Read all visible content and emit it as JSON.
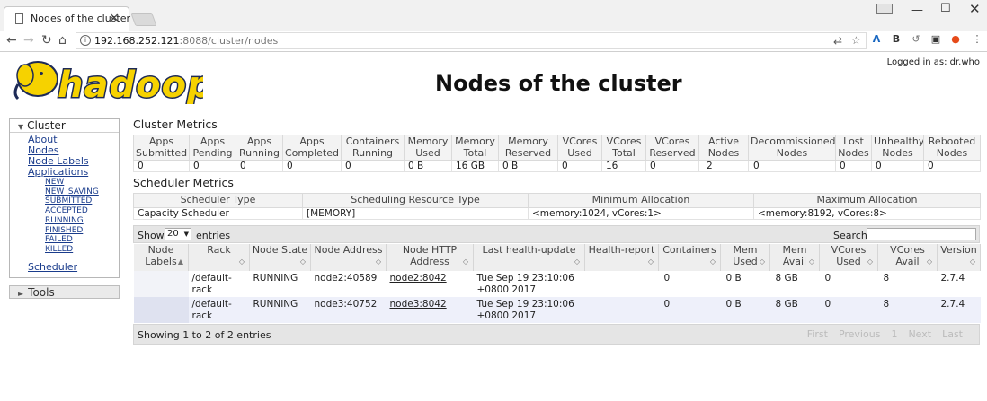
{
  "browser": {
    "tab_title": "Nodes of the cluster",
    "url_host": "192.168.252.121",
    "url_path": ":8088/cluster/nodes"
  },
  "header": {
    "logo_text": "hadoop",
    "title": "Nodes of the cluster",
    "logged_in": "Logged in as: dr.who"
  },
  "sidebar": {
    "cluster_label": "Cluster",
    "links": [
      "About",
      "Nodes",
      "Node Labels",
      "Applications"
    ],
    "app_states": [
      "NEW",
      "NEW_SAVING",
      "SUBMITTED",
      "ACCEPTED",
      "RUNNING",
      "FINISHED",
      "FAILED",
      "KILLED"
    ],
    "scheduler_label": "Scheduler",
    "tools_label": "Tools"
  },
  "cluster_metrics": {
    "title": "Cluster Metrics",
    "headers": [
      [
        "Apps",
        "Submitted"
      ],
      [
        "Apps",
        "Pending"
      ],
      [
        "Apps",
        "Running"
      ],
      [
        "Apps",
        "Completed"
      ],
      [
        "Containers",
        "Running"
      ],
      [
        "Memory",
        "Used"
      ],
      [
        "Memory",
        "Total"
      ],
      [
        "Memory",
        "Reserved"
      ],
      [
        "VCores",
        "Used"
      ],
      [
        "VCores",
        "Total"
      ],
      [
        "VCores",
        "Reserved"
      ],
      [
        "Active",
        "Nodes"
      ],
      [
        "Decommissioned",
        "Nodes"
      ],
      [
        "Lost",
        "Nodes"
      ],
      [
        "Unhealthy",
        "Nodes"
      ],
      [
        "Rebooted",
        "Nodes"
      ]
    ],
    "values": [
      "0",
      "0",
      "0",
      "0",
      "0",
      "0 B",
      "16 GB",
      "0 B",
      "0",
      "16",
      "0",
      "2",
      "0",
      "0",
      "0",
      "0"
    ]
  },
  "scheduler_metrics": {
    "title": "Scheduler Metrics",
    "headers": [
      "Scheduler Type",
      "Scheduling Resource Type",
      "Minimum Allocation",
      "Maximum Allocation"
    ],
    "values": [
      "Capacity Scheduler",
      "[MEMORY]",
      "<memory:1024, vCores:1>",
      "<memory:8192, vCores:8>"
    ]
  },
  "nodes_table": {
    "show_label": "Show",
    "page_size": "20",
    "entries_label": "entries",
    "search_label": "Search:",
    "headers": [
      [
        "Node",
        "Labels"
      ],
      [
        "Rack"
      ],
      [
        "Node State"
      ],
      [
        "Node Address"
      ],
      [
        "Node HTTP",
        "Address"
      ],
      [
        "Last health-update"
      ],
      [
        "Health-report"
      ],
      [
        "Containers"
      ],
      [
        "Mem",
        "Used"
      ],
      [
        "Mem",
        "Avail"
      ],
      [
        "VCores",
        "Used"
      ],
      [
        "VCores",
        "Avail"
      ],
      [
        "Version"
      ]
    ],
    "rows": [
      [
        "",
        "/default-rack",
        "RUNNING",
        "node2:40589",
        "node2:8042",
        "Tue Sep 19 23:10:06 +0800 2017",
        "",
        "0",
        "0 B",
        "8 GB",
        "0",
        "8",
        "2.7.4"
      ],
      [
        "",
        "/default-rack",
        "RUNNING",
        "node3:40752",
        "node3:8042",
        "Tue Sep 19 23:10:06 +0800 2017",
        "",
        "0",
        "0 B",
        "8 GB",
        "0",
        "8",
        "2.7.4"
      ]
    ],
    "footer_info": "Showing 1 to 2 of 2 entries",
    "pager": [
      "First",
      "Previous",
      "1",
      "Next",
      "Last"
    ]
  }
}
